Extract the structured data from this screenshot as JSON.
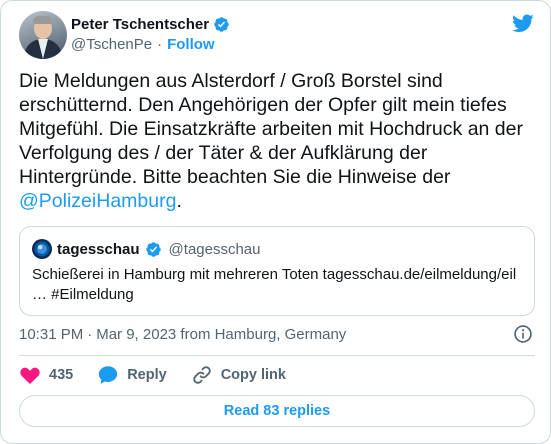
{
  "author": {
    "name": "Peter Tschentscher",
    "handle": "@TschenPe",
    "separator": "·",
    "follow_label": "Follow"
  },
  "tweet": {
    "text_main": "Die Meldungen aus Alsterdorf / Groß Borstel sind erschütternd. Den Angehörigen der Opfer gilt mein tiefes Mitgefühl. Die Einsatzkräfte arbeiten mit Hochdruck an der Verfolgung des / der Täter & der Aufklärung der Hintergründe. Bitte beachten Sie die Hinweise der ",
    "mention": "@PolizeiHamburg",
    "text_end": "."
  },
  "quote": {
    "name": "tagesschau",
    "handle": "@tagesschau",
    "text": "Schießerei in Hamburg mit mehreren Toten tagesschau.de/eilmeldung/eil … #Eilmeldung"
  },
  "meta": {
    "time": "10:31 PM",
    "separator": "·",
    "date_location": "Mar 9, 2023 from Hamburg, Germany"
  },
  "actions": {
    "like_count": "435",
    "reply_label": "Reply",
    "copy_label": "Copy link"
  },
  "read_replies_label": "Read 83 replies",
  "colors": {
    "accent": "#1d9bf0",
    "like": "#f91880",
    "text": "#0f1419",
    "secondary": "#536471",
    "border": "#cfd9de",
    "tagesschau_blue": "#005ca8"
  },
  "icons": {
    "verified": "verified-badge-icon",
    "brand": "twitter-bird-icon",
    "info": "info-icon",
    "like": "heart-icon",
    "reply": "speech-bubble-icon",
    "copy": "link-icon"
  }
}
